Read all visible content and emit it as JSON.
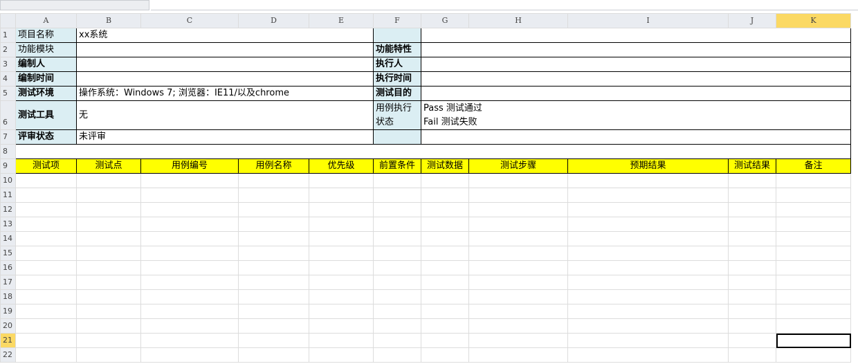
{
  "columns": [
    "A",
    "B",
    "C",
    "D",
    "E",
    "F",
    "G",
    "H",
    "I",
    "J",
    "K"
  ],
  "rows": [
    "1",
    "2",
    "3",
    "4",
    "5",
    "6",
    "7",
    "8",
    "9",
    "10",
    "11",
    "12",
    "13",
    "14",
    "15",
    "16",
    "17",
    "18",
    "19",
    "20",
    "21",
    "22"
  ],
  "info": {
    "project_name_label": "项目名称",
    "project_name_value": "xx系统",
    "module_label": "功能模块",
    "feature_label": "功能特性",
    "author_label": "编制人",
    "executor_label": "执行人",
    "compile_time_label": "编制时间",
    "exec_time_label": "执行时间",
    "env_label": "测试环境",
    "env_value": "操作系统：Windows 7; 浏览器：IE11/以及chrome",
    "purpose_label": "测试目的",
    "tool_label": "测试工具",
    "tool_value": "无",
    "status_label_line1": "用例执行",
    "status_label_line2": "状态",
    "status_pass": "Pass 测试通过",
    "status_fail": "Fail  测试失败",
    "review_label": "评审状态",
    "review_value": "未评审"
  },
  "table_headers": [
    "测试项",
    "测试点",
    "用例编号",
    "用例名称",
    "优先级",
    "前置条件",
    "测试数据",
    "测试步骤",
    "预期结果",
    "测试结果",
    "备注"
  ],
  "selection": {
    "column": "K",
    "row": "21"
  },
  "colors": {
    "label_fill": "#dbeef3",
    "header_fill": "#ffff00",
    "selected_header": "#fbd964"
  }
}
